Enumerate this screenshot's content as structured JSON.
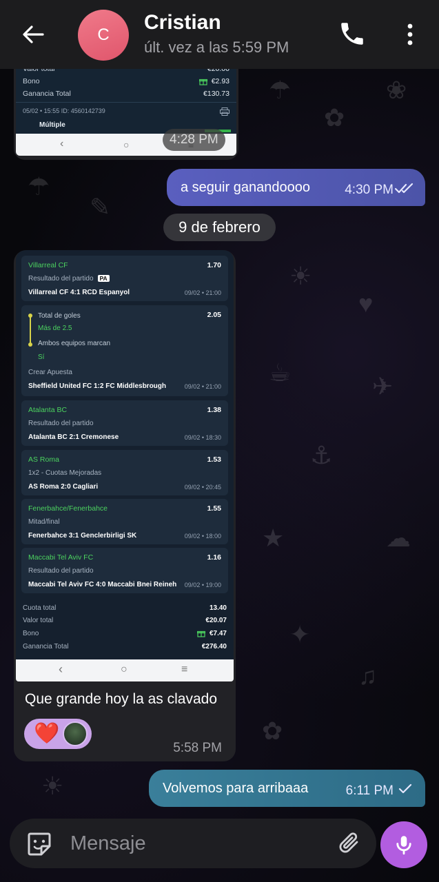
{
  "header": {
    "avatar_letter": "C",
    "contact_name": "Cristian",
    "last_seen": "últ. vez a las 5:59 PM"
  },
  "top_receipt": {
    "rows": [
      {
        "label": "Valor total",
        "value": "€20.00"
      },
      {
        "label": "Bono",
        "value": "€2.93"
      },
      {
        "label": "Ganancia Total",
        "value": "€130.73"
      }
    ],
    "footer": "05/02 • 15:55   ID: 4560142739",
    "next_label": "Múltiple",
    "time": "4:28 PM"
  },
  "outgoing_1": {
    "text": "a seguir ganandoooo",
    "time": "4:30 PM",
    "status": "read-double-check"
  },
  "date_separator": "9 de febrero",
  "bet_slip": {
    "selections": [
      {
        "team": "Villarreal CF",
        "odds": "1.70",
        "market": "Resultado del partido",
        "badge": "PA",
        "result": "Villarreal CF 4:1 RCD Espanyol",
        "date": "09/02 • 21:00"
      },
      {
        "team": "",
        "odds": "2.05",
        "market": "Total de goles",
        "pick": "Más de 2.5",
        "market2": "Ambos equipos marcan",
        "pick2": "Sí",
        "extra": "Crear Apuesta",
        "result": "Sheffield United FC 1:2 FC Middlesbrough",
        "date": "09/02 • 21:00"
      },
      {
        "team": "Atalanta BC",
        "odds": "1.38",
        "market": "Resultado del partido",
        "result": "Atalanta BC 2:1 Cremonese",
        "date": "09/02 • 18:30"
      },
      {
        "team": "AS Roma",
        "odds": "1.53",
        "market": "1x2 - Cuotas Mejoradas",
        "result": "AS Roma 2:0 Cagliari",
        "date": "09/02 • 20:45"
      },
      {
        "team": "Fenerbahce/Fenerbahce",
        "odds": "1.55",
        "market": "Mitad/final",
        "result": "Fenerbahce 3:1 Genclerbirligi SK",
        "date": "09/02 • 18:00"
      },
      {
        "team": "Maccabi Tel Aviv FC",
        "odds": "1.16",
        "market": "Resultado del partido",
        "result": "Maccabi Tel Aviv FC 4:0 Maccabi Bnei Reineh",
        "date": "09/02 • 19:00"
      }
    ],
    "totals": [
      {
        "label": "Cuota total",
        "value": "13.40"
      },
      {
        "label": "Valor total",
        "value": "€20.07"
      },
      {
        "label": "Bono",
        "value": "€7.47"
      },
      {
        "label": "Ganancia Total",
        "value": "€276.40"
      }
    ]
  },
  "incoming": {
    "caption": "Que grande hoy la as clavado",
    "reaction": "❤️",
    "time": "5:58 PM"
  },
  "outgoing_2": {
    "text": "Volvemos para arribaaa",
    "time": "6:11 PM",
    "status": "sent-single-check"
  },
  "composer": {
    "placeholder": "Mensaje"
  },
  "colors": {
    "accent": "#b25de0",
    "outgoing_1": "#5a5fbf",
    "outgoing_2": "#3a7f9a",
    "win_green": "#4cd35f"
  }
}
